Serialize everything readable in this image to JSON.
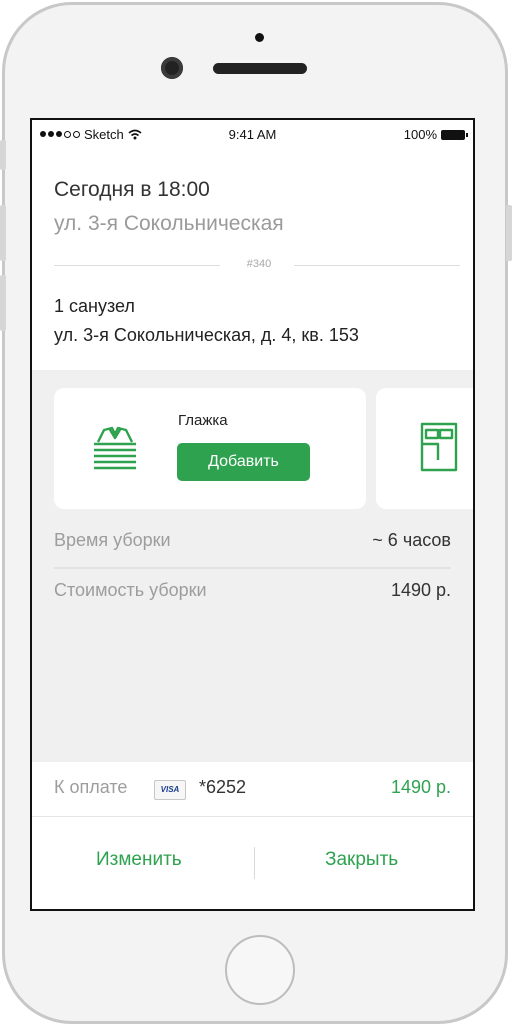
{
  "status_bar": {
    "carrier": "Sketch",
    "time": "9:41 AM",
    "battery": "100%"
  },
  "order": {
    "title": "Сегодня в 18:00",
    "subtitle": "ул. 3-я Сокольническая",
    "number": "#340",
    "rooms": "1 санузел",
    "address": "ул. 3-я Сокольническая, д. 4, кв. 153"
  },
  "services": [
    {
      "name": "Глажка",
      "button_label": "Добавить",
      "icon": "shirt-icon"
    },
    {
      "name": "",
      "icon": "bed-sheet-icon"
    }
  ],
  "summary": {
    "time_label": "Время уборки",
    "time_value": "~ 6 часов",
    "cost_label": "Стоимость уборки",
    "cost_value": "1490 р."
  },
  "payment": {
    "label": "К оплате",
    "card_brand": "VISA",
    "card_number": "*6252",
    "amount": "1490 р."
  },
  "actions": {
    "edit": "Изменить",
    "close": "Закрыть"
  },
  "colors": {
    "accent": "#2ea24f",
    "background_gray": "#f0f0f0"
  }
}
